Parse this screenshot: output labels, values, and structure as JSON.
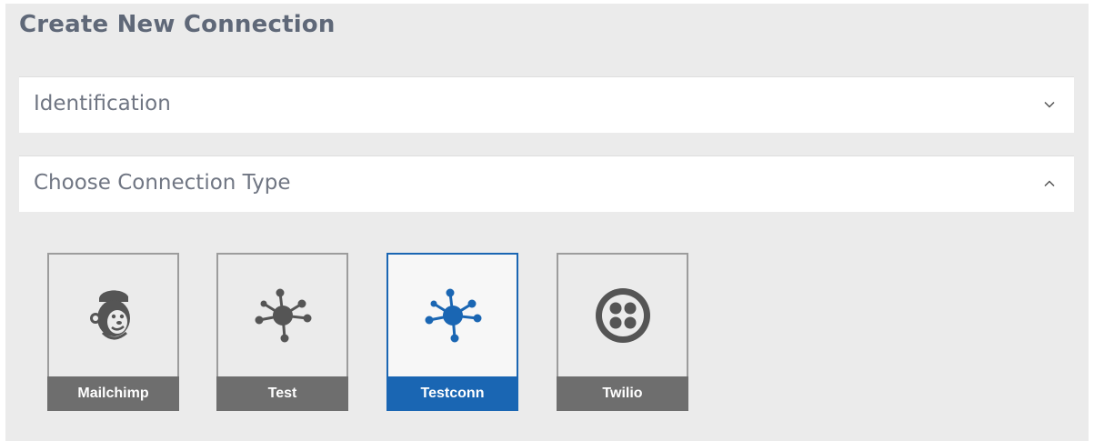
{
  "page": {
    "title": "Create New Connection"
  },
  "sections": {
    "identification": {
      "title": "Identification",
      "expanded": false
    },
    "connection_type": {
      "title": "Choose Connection Type",
      "expanded": true
    }
  },
  "connection_types": [
    {
      "label": "Mailchimp",
      "icon": "mailchimp-icon",
      "selected": false
    },
    {
      "label": "Test",
      "icon": "network-icon",
      "selected": false
    },
    {
      "label": "Testconn",
      "icon": "network-icon",
      "selected": true
    },
    {
      "label": "Twilio",
      "icon": "twilio-icon",
      "selected": false
    }
  ],
  "colors": {
    "panel_bg": "#ebebeb",
    "title_text": "#5f6878",
    "section_text": "#707683",
    "card_border": "#9c9c9c",
    "card_label_bg": "#6e6e6e",
    "accent": "#1a66b3",
    "icon_gray": "#555555"
  }
}
